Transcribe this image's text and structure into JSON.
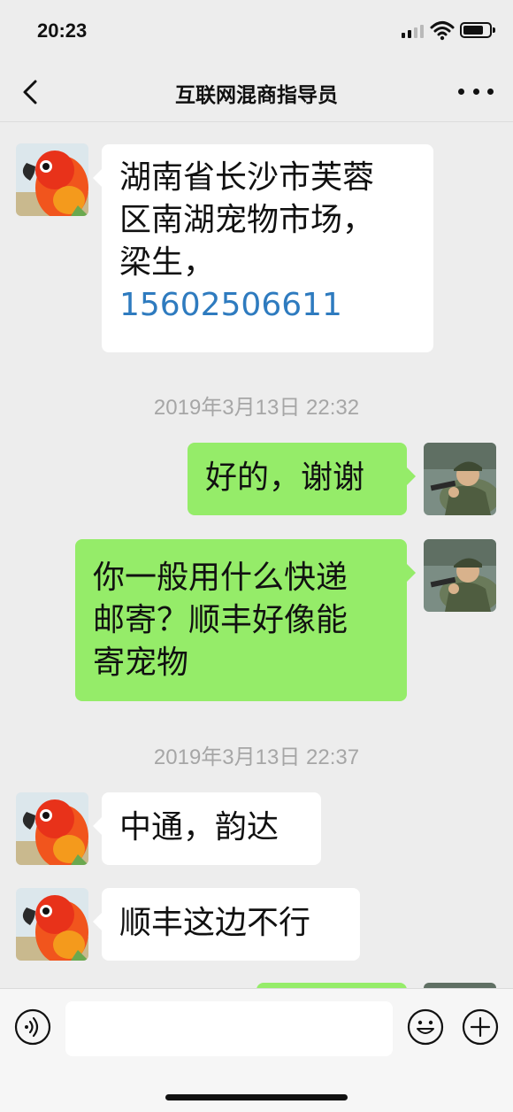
{
  "status_bar": {
    "time": "20:23"
  },
  "nav": {
    "title": "互联网混商指导员"
  },
  "messages": [
    {
      "lines": [
        "湖南省长沙市芙蓉",
        "区南湖宠物市场，",
        "梁生，"
      ],
      "phone": "15602506611"
    },
    {
      "timestamp": "2019年3月13日 22:32"
    },
    {
      "text": "好的，谢谢"
    },
    {
      "lines": [
        "你一般用什么快递",
        "邮寄？顺丰好像能",
        "寄宠物"
      ]
    },
    {
      "timestamp": "2019年3月13日 22:37"
    },
    {
      "text": "中通，韵达"
    },
    {
      "text": "顺丰这边不行"
    }
  ],
  "colors": {
    "outgoing_bubble": "#95ec69",
    "incoming_bubble": "#ffffff",
    "link": "#2e7bbf",
    "background": "#ededed"
  },
  "icons": [
    "back-icon",
    "more-icon",
    "voice-icon",
    "emoji-icon",
    "plus-icon"
  ]
}
